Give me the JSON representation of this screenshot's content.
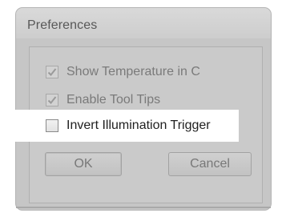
{
  "window": {
    "title": "Preferences"
  },
  "options": [
    {
      "label": "Show Temperature in C",
      "checked": true,
      "active": false
    },
    {
      "label": "Enable Tool Tips",
      "checked": true,
      "active": false
    },
    {
      "label": "Invert Illumination Trigger",
      "checked": false,
      "active": true
    }
  ],
  "buttons": {
    "ok_label": "OK",
    "cancel_label": "Cancel"
  },
  "colors": {
    "dialog_bg": "#c6c6c6",
    "highlight": "#ffffff",
    "disabled_text": "#7a7a7a",
    "active_text": "#1f1f1f"
  },
  "icons": {
    "checkmark": "checkmark-icon"
  }
}
